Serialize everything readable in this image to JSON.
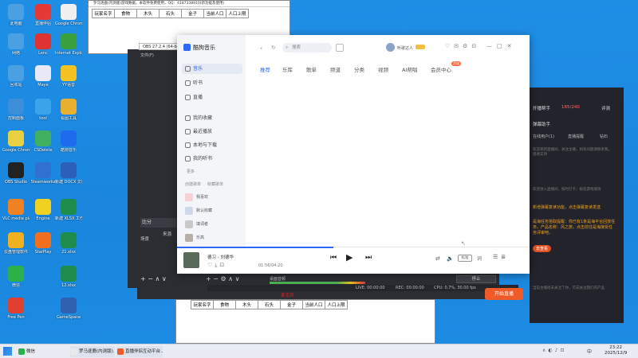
{
  "desktop": {
    "icons": [
      {
        "label": "此电脑",
        "color": "#4aa0e0"
      },
      {
        "label": "直播伴侣",
        "color": "#e53935"
      },
      {
        "label": "Google Chrome",
        "color": "#f0f0f0"
      },
      {
        "label": "网络",
        "color": "#4aa0e0"
      },
      {
        "label": "Lenc",
        "color": "#d33"
      },
      {
        "label": "Internet Explorer",
        "color": "#3aa040"
      },
      {
        "label": "回收站",
        "color": "#4aa0e0"
      },
      {
        "label": "Maye",
        "color": "#e8e8f8"
      },
      {
        "label": "YY语音",
        "color": "#f3c220"
      },
      {
        "label": "控制面板",
        "color": "#3a8fd8"
      },
      {
        "label": "tool",
        "color": "#3aa4e8"
      },
      {
        "label": "看图工具",
        "color": "#e8b030"
      },
      {
        "label": "Google Chrome",
        "color": "#e8d040"
      },
      {
        "label": "CSDelete",
        "color": "#40b060"
      },
      {
        "label": "酷狗音乐",
        "color": "#1f6bf0"
      },
      {
        "label": "OBS Studio",
        "color": "#222"
      },
      {
        "label": "Steamworks",
        "color": "#3070d0"
      },
      {
        "label": "新建 DOCX 文档",
        "color": "#2b5fb8"
      },
      {
        "label": "VLC media player",
        "color": "#f08020"
      },
      {
        "label": "Engine",
        "color": "#f0d020"
      },
      {
        "label": "新建 XLSX 工作表",
        "color": "#1e8c4a"
      },
      {
        "label": "云盘管理软件",
        "color": "#f0b020"
      },
      {
        "label": "StarPlay",
        "color": "#f07020"
      },
      {
        "label": "21.xlsx",
        "color": "#1e8c4a"
      },
      {
        "label": "微信",
        "color": "#2ab14a"
      },
      {
        "label": "12.xlsx",
        "color": "#1e8c4a"
      },
      {
        "label": "Free Pen",
        "color": "#e04030"
      },
      {
        "label": "GameSpace",
        "color": "#3060b0"
      }
    ]
  },
  "sheet_top": {
    "title": "罗马逐鹿(内测版)游戏数据，本软件免费使用，QQ：4187338910(新功能及使用)",
    "headers": [
      "玩家名字",
      "食物",
      "木头",
      "石头",
      "金子",
      "当前人口",
      "人口上限"
    ]
  },
  "sheet_bottom": {
    "headers": [
      "玩家名字",
      "食物",
      "木头",
      "石头",
      "金子",
      "当前人口",
      "人口上限"
    ]
  },
  "obs": {
    "title": "OBS 27.2.4 (64-bit, windows)",
    "menu": "文件(F)",
    "scene_label": "场景",
    "source_label": "来源",
    "sub_label": "比分",
    "audio_label": "桌面音频",
    "mic_label": "麦克风",
    "status_live": "LIVE: 00:00:00",
    "status_rec": "REC: 00:00:00",
    "status_cpu": "CPU: 0.7%, 30.00 fps",
    "db_scale": "-60 -55 -50 -45 -40 -35 -30 -25 -20 -15 -10 -5 0",
    "stop_label": "停止"
  },
  "music": {
    "app_name": "酷狗音乐",
    "search_placeholder": "搜索",
    "user_name": "听歌达人",
    "nav_main": [
      {
        "label": "音乐",
        "active": true
      },
      {
        "label": "听书",
        "active": false
      },
      {
        "label": "直播",
        "active": false
      }
    ],
    "nav_mine": [
      {
        "label": "我的收藏"
      },
      {
        "label": "最近播放"
      },
      {
        "label": "本地与下载"
      },
      {
        "label": "我的听书"
      }
    ],
    "more_label": "更多",
    "playlist_header": "创建歌单",
    "playlist_tab2": "收藏歌单",
    "playlists": [
      "我喜欢",
      "默认收藏",
      "填词者",
      "乐高"
    ],
    "tabs": [
      {
        "label": "推荐",
        "active": true
      },
      {
        "label": "乐库",
        "active": false
      },
      {
        "label": "歌单",
        "active": false
      },
      {
        "label": "频道",
        "active": false
      },
      {
        "label": "分类",
        "active": false
      },
      {
        "label": "视频",
        "active": false
      },
      {
        "label": "AI帮唱",
        "active": false
      },
      {
        "label": "会员中心",
        "active": false
      }
    ],
    "vip_badge": "活动",
    "track_title": "德习 - 刘德华",
    "time_current": "01:56",
    "time_total": "04:20",
    "quality_label": "标准",
    "lyric_label": "词"
  },
  "live": {
    "title": "开播帮手",
    "counter": "165/240",
    "menu_label": "评测",
    "section": "弹幕助手",
    "tabs": [
      "在线用户(1)",
      "直播提醒",
      "钻石"
    ],
    "msg1": "欢迎来到直播间，关注主播，如有问题请联系我，感谢支持",
    "msg2": "欢迎进入直播间，按时打卡，祝您游戏愉快",
    "notice1": "新增弹幕复读功能，点击弹幕复读发送",
    "notice2": "是海任务拾取提醒：你已有1条是海平台回放任务，产品名称：风之旅，点击前往是海接受任务评审吧。",
    "accept_label": "去查看",
    "start_button": "开始直播",
    "footer": "当前主播尚未关注了你，可去关注我们的产品"
  },
  "taskbar": {
    "start_icon": "windows-start-icon",
    "apps": [
      {
        "label": "微信"
      },
      {
        "label": "罗马逐鹿(内测版)..."
      },
      {
        "label": "直播伴侣互动平台..."
      }
    ],
    "time": "23:22",
    "date": "2025/12/9",
    "lang": "中"
  }
}
